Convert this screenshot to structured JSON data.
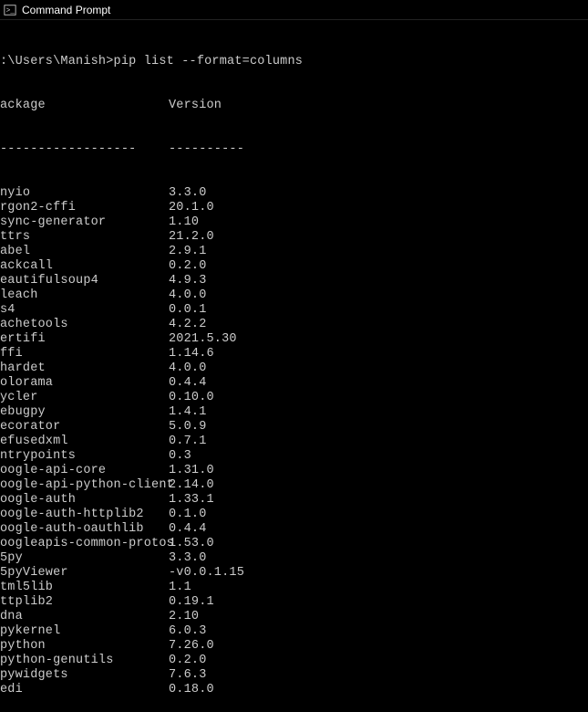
{
  "window": {
    "title": "Command Prompt"
  },
  "prompt": {
    "line": ":\\Users\\Manish>pip list --format=columns"
  },
  "header": {
    "package": "ackage",
    "version": "Version",
    "sep_package": "------------------",
    "sep_version": "----------"
  },
  "packages": [
    {
      "name": "nyio",
      "version": "3.3.0"
    },
    {
      "name": "rgon2-cffi",
      "version": "20.1.0"
    },
    {
      "name": "sync-generator",
      "version": "1.10"
    },
    {
      "name": "ttrs",
      "version": "21.2.0"
    },
    {
      "name": "abel",
      "version": "2.9.1"
    },
    {
      "name": "ackcall",
      "version": "0.2.0"
    },
    {
      "name": "eautifulsoup4",
      "version": "4.9.3"
    },
    {
      "name": "leach",
      "version": "4.0.0"
    },
    {
      "name": "s4",
      "version": "0.0.1"
    },
    {
      "name": "achetools",
      "version": "4.2.2"
    },
    {
      "name": "ertifi",
      "version": "2021.5.30"
    },
    {
      "name": "ffi",
      "version": "1.14.6"
    },
    {
      "name": "hardet",
      "version": "4.0.0"
    },
    {
      "name": "olorama",
      "version": "0.4.4"
    },
    {
      "name": "ycler",
      "version": "0.10.0"
    },
    {
      "name": "ebugpy",
      "version": "1.4.1"
    },
    {
      "name": "ecorator",
      "version": "5.0.9"
    },
    {
      "name": "efusedxml",
      "version": "0.7.1"
    },
    {
      "name": "ntrypoints",
      "version": "0.3"
    },
    {
      "name": "oogle-api-core",
      "version": "1.31.0"
    },
    {
      "name": "oogle-api-python-client",
      "version": "2.14.0"
    },
    {
      "name": "oogle-auth",
      "version": "1.33.1"
    },
    {
      "name": "oogle-auth-httplib2",
      "version": "0.1.0"
    },
    {
      "name": "oogle-auth-oauthlib",
      "version": "0.4.4"
    },
    {
      "name": "oogleapis-common-protos",
      "version": "1.53.0"
    },
    {
      "name": "5py",
      "version": "3.3.0"
    },
    {
      "name": "5pyViewer",
      "version": "-v0.0.1.15"
    },
    {
      "name": "tml5lib",
      "version": "1.1"
    },
    {
      "name": "ttplib2",
      "version": "0.19.1"
    },
    {
      "name": "dna",
      "version": "2.10"
    },
    {
      "name": "pykernel",
      "version": "6.0.3"
    },
    {
      "name": "python",
      "version": "7.26.0"
    },
    {
      "name": "python-genutils",
      "version": "0.2.0"
    },
    {
      "name": "pywidgets",
      "version": "7.6.3"
    },
    {
      "name": "edi",
      "version": "0.18.0"
    }
  ]
}
